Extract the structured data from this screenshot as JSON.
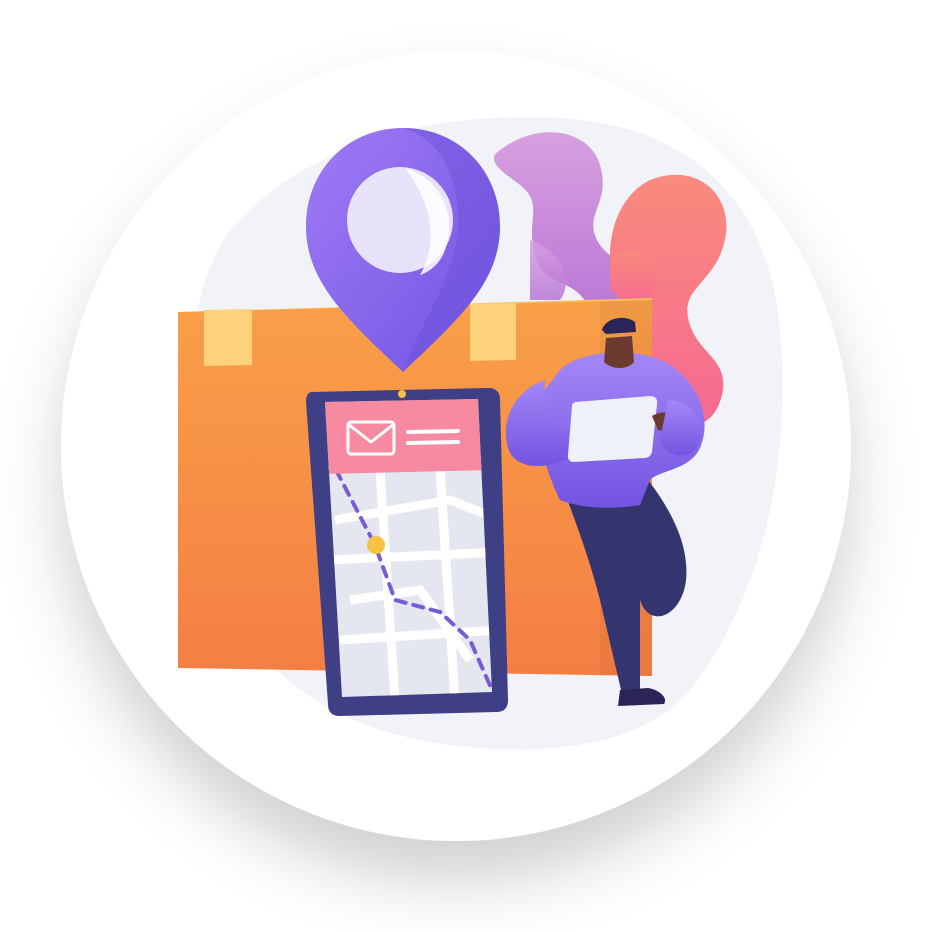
{
  "illustration": {
    "colors": {
      "background": "#ffffff",
      "circle": "#ffffff",
      "blob": "#f1f3f8",
      "box_front": "#f9a048",
      "box_top": "#fcc05e",
      "tape": "#fdd27a",
      "pin": "#8b6cf0",
      "pin_hole": "#e8e2fb",
      "plant_purple": "#c98ad8",
      "plant_pink": "#f77a86",
      "phone_frame": "#3f3f85",
      "phone_screen": "#e4e7ef",
      "phone_header": "#f58aa0",
      "route": "#7a5bd6",
      "map_marker": "#f6c244",
      "shirt": "#8f6fee",
      "pants": "#34356f",
      "skin": "#6b3b2f",
      "tablet": "#eef1f7"
    },
    "icons": [
      "location-pin-icon",
      "envelope-icon",
      "map-marker-icon"
    ]
  }
}
